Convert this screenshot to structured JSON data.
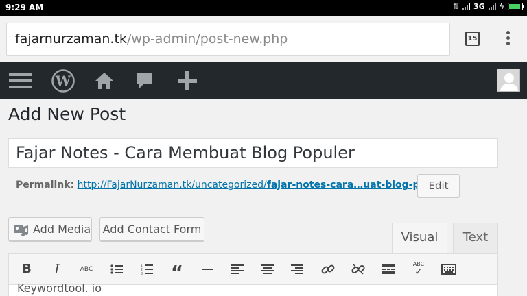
{
  "status_bar": {
    "time": "9:29 AM",
    "network": "3G"
  },
  "browser": {
    "url_host": "fajarnurzaman.tk",
    "url_path": "/wp-admin/post-new.php",
    "tab_count": "15"
  },
  "admin_bar": {
    "icons": [
      "menu-icon",
      "wordpress-logo",
      "home-icon",
      "comment-icon",
      "plus-icon",
      "user-avatar"
    ]
  },
  "page": {
    "title": "Add New Post",
    "post_title_value": "Fajar Notes - Cara Membuat Blog Populer",
    "permalink_label": "Permalink:",
    "permalink_base": "http://FajarNurzaman.tk/uncategorized/",
    "permalink_slug": "fajar-notes-cara…uat-blog-populer",
    "permalink_trail": "/",
    "edit_label": "Edit"
  },
  "media_buttons": {
    "add_media": "Add Media",
    "add_contact_form": "Add Contact Form"
  },
  "editor_tabs": {
    "visual": "Visual",
    "text": "Text"
  },
  "toolbar": {
    "bold": "B",
    "italic": "I",
    "strikethrough": "ABC",
    "spellcheck": "ABC",
    "buttons": [
      "bold",
      "italic",
      "strikethrough",
      "bulleted-list",
      "numbered-list",
      "blockquote",
      "horizontal-line",
      "align-left",
      "align-center",
      "align-right",
      "insert-link",
      "remove-link",
      "read-more",
      "spellcheck",
      "toolbar-toggle"
    ]
  },
  "editor": {
    "content_partial": "Keywordtool. io"
  },
  "colors": {
    "admin_bar": "#23282d",
    "link": "#0073aa",
    "battery": "#46d160"
  }
}
